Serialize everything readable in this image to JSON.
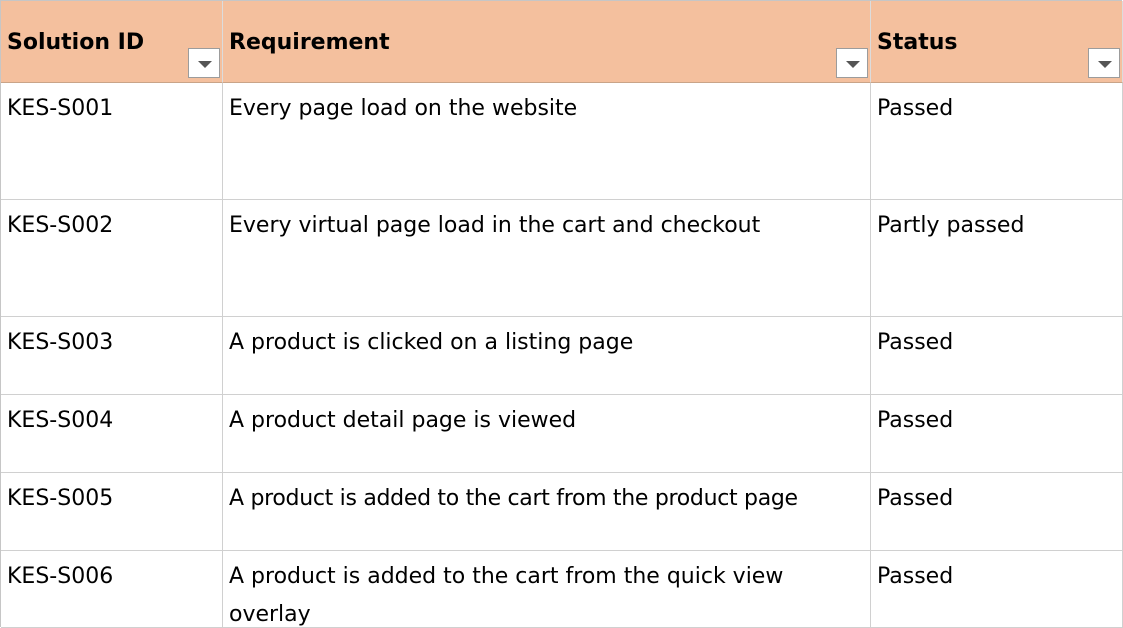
{
  "table": {
    "headers": [
      "Solution ID",
      "Requirement",
      "Status"
    ],
    "rows": [
      {
        "id": "KES-S001",
        "requirement": "Every page load on the website",
        "status": "Passed"
      },
      {
        "id": "KES-S002",
        "requirement": "Every virtual page load in the cart and checkout",
        "status": "Partly passed"
      },
      {
        "id": "KES-S003",
        "requirement": "A product is clicked on a listing page",
        "status": "Passed"
      },
      {
        "id": "KES-S004",
        "requirement": "A product detail page is viewed",
        "status": "Passed"
      },
      {
        "id": "KES-S005",
        "requirement": "A product is added to the cart from the product page",
        "status": "Passed"
      },
      {
        "id": "KES-S006",
        "requirement": "A product is added to the cart from the quick view overlay",
        "status": "Passed"
      }
    ]
  },
  "colors": {
    "header_fill": "#f4c09e",
    "gridline": "#d0d0d0"
  },
  "icons": {
    "filter": "chevron-down-icon"
  }
}
